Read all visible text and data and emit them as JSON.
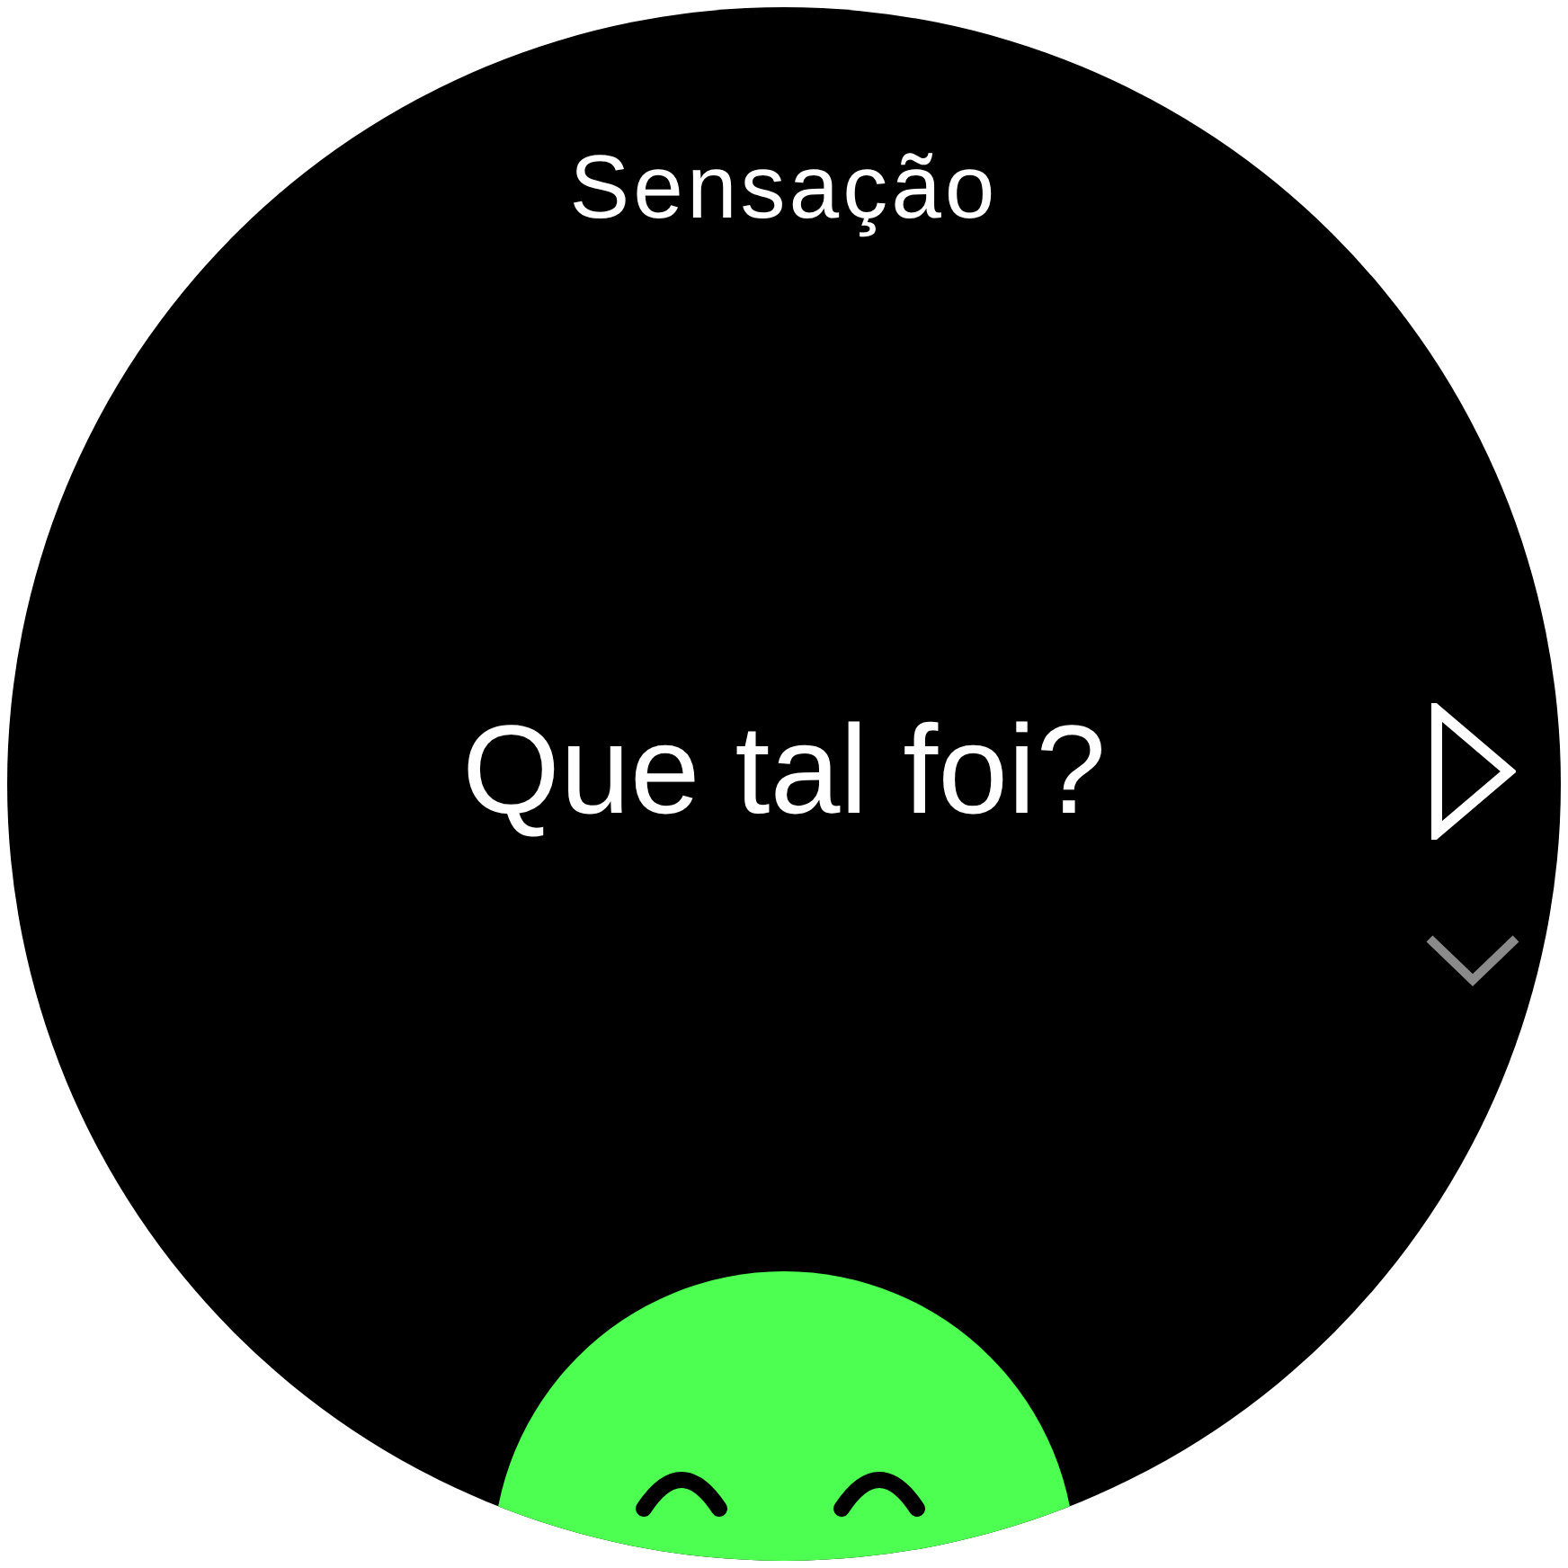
{
  "title": "Sensação",
  "question": "Que tal foi?"
}
